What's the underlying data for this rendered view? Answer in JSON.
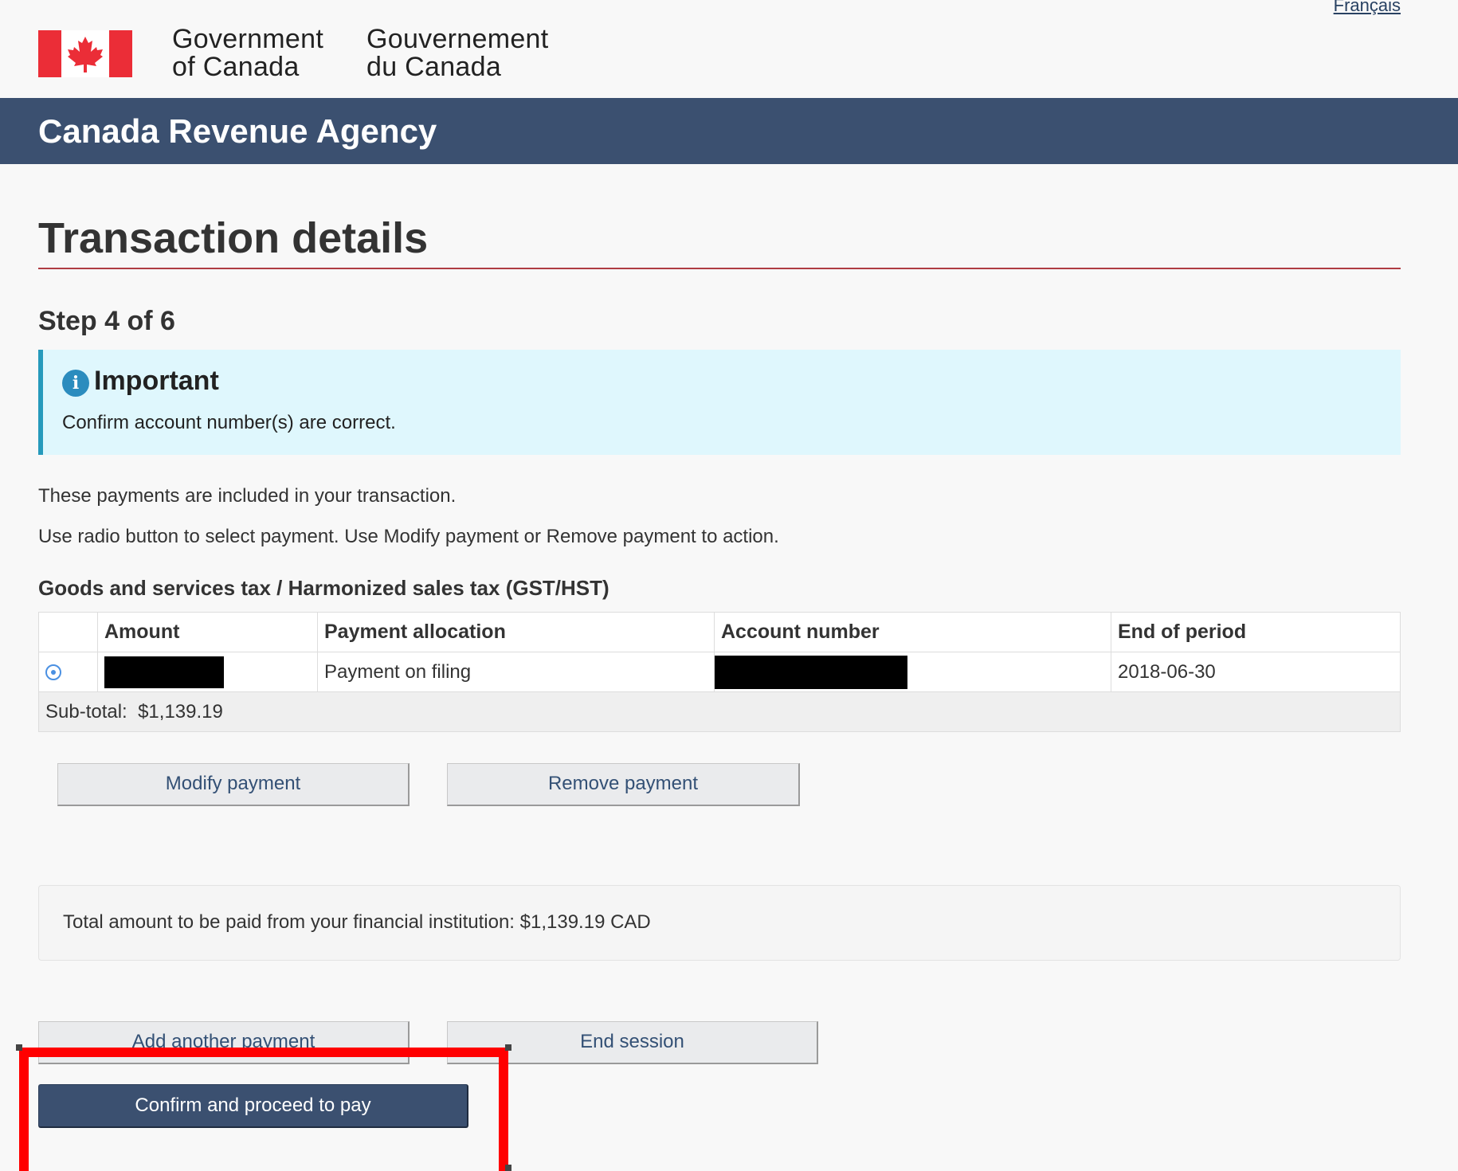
{
  "header": {
    "language_link": "Français",
    "signature_en_line1": "Government",
    "signature_en_line2": "of Canada",
    "signature_fr_line1": "Gouvernement",
    "signature_fr_line2": "du Canada",
    "agency_name": "Canada Revenue Agency",
    "flag_icon": "canada-flag-icon",
    "flag_colors": {
      "red": "#eb2d37",
      "white": "#ffffff"
    }
  },
  "main": {
    "title": "Transaction details",
    "step": "Step 4 of 6",
    "alert": {
      "icon": "info-icon",
      "heading": "Important",
      "text": "Confirm account number(s) are correct."
    },
    "intro_lines": [
      "These payments are included in your transaction.",
      "Use radio button to select payment. Use Modify payment or Remove payment to action."
    ],
    "section_heading": "Goods and services tax / Harmonized sales tax (GST/HST)",
    "table": {
      "headers": [
        "Amount",
        "Payment allocation",
        "Account number",
        "End of period"
      ],
      "rows": [
        {
          "selected": true,
          "amount": "[redacted]",
          "allocation": "Payment on filing",
          "account_number": "[redacted]",
          "end_of_period": "2018-06-30"
        }
      ],
      "subtotal_label": "Sub-total:",
      "subtotal_value": "$1,139.19"
    },
    "row_actions": {
      "modify_label": "Modify payment",
      "remove_label": "Remove payment"
    },
    "total_text": "Total amount to be paid from your financial institution: $1,139.19 CAD",
    "footer_actions": {
      "add_label": "Add another payment",
      "end_label": "End session",
      "confirm_label": "Confirm and proceed to pay"
    }
  },
  "colors": {
    "agency_bar": "#3b5070",
    "title_rule": "#af3c43",
    "alert_background": "#dff7fd",
    "alert_border": "#269abc",
    "highlight_annotation": "#ff0000"
  }
}
